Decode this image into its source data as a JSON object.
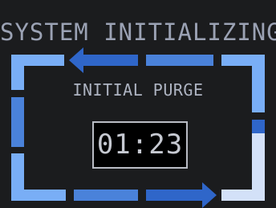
{
  "screen": {
    "title": "SYSTEM INITIALIZING",
    "subtitle": "INITIAL PURGE",
    "timer": "01:23"
  },
  "frame": {
    "colors": {
      "light_blue": "#79aef6",
      "mid_blue": "#4a82da",
      "pale_blue": "#d3e1f8",
      "arrow_blue": "#2f66c9"
    },
    "arrows": [
      "arrow-left-icon",
      "arrow-right-icon"
    ]
  }
}
